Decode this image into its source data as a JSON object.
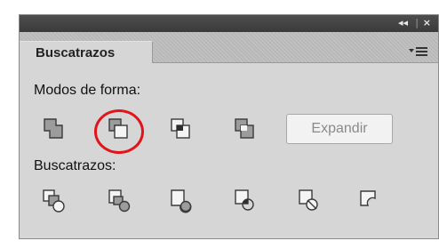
{
  "panel": {
    "title": "Buscatrazos",
    "collapse_label": "◂◂",
    "close_label": "×",
    "menu_icon": "panel-menu-icon"
  },
  "shape_modes": {
    "label": "Modos de forma:",
    "icons": [
      "unite-icon",
      "minus-front-icon",
      "intersect-icon",
      "exclude-icon"
    ],
    "highlighted": "minus-front-icon",
    "expand_label": "Expandir"
  },
  "pathfinders": {
    "label": "Buscatrazos:",
    "icons": [
      "divide-icon",
      "trim-icon",
      "merge-icon",
      "crop-icon",
      "outline-icon",
      "minus-back-icon"
    ]
  },
  "colors": {
    "highlight": "#e0141a",
    "panel_bg": "#d6d6d6",
    "titlebar": "#404040"
  }
}
